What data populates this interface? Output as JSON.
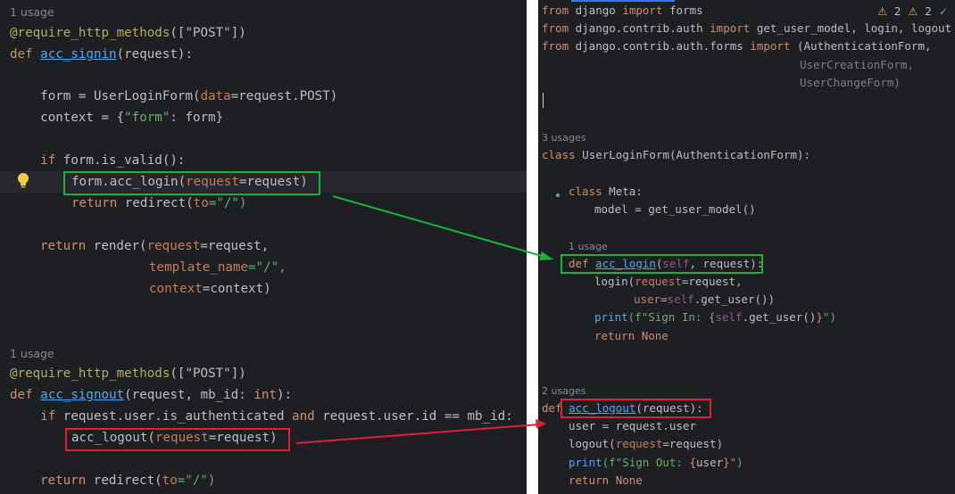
{
  "left": {
    "usage1": "1 usage",
    "deco1": "@require_http_methods",
    "deco1_arg": "([\"POST\"])",
    "def_kw": "def ",
    "signin_name": "acc_signin",
    "signin_sig": "(request):",
    "form_line": "    form = UserLoginForm(",
    "form_data_kw": "data",
    "form_data_val": "=request.POST)",
    "ctx_pre": "    context = {",
    "ctx_key": "\"form\"",
    "ctx_post": ": form}",
    "if_kw": "    if",
    "if_rest": " form.is_valid():",
    "login_call": "form.acc_login(",
    "login_param": "request",
    "login_val": "=request)",
    "return_kw": "return",
    "redirect_pre": " redirect(",
    "to_param": "to",
    "redirect_str": "=\"/\")",
    "render_pre": " render(",
    "req_param": "request",
    "req_val": "=request,",
    "tmpl_param": "template_name",
    "tmpl_val": "=\"/\",",
    "ctx_param": "context",
    "ctx_val": "=context)",
    "usage2": "1 usage",
    "deco2": "@require_http_methods",
    "deco2_arg": "([\"POST\"])",
    "signout_name": "acc_signout",
    "signout_sig": "(request, mb_id: ",
    "int_kw": "int",
    "signout_end": "):",
    "if2_mid": " request.user.is_authenticated ",
    "and_kw": "and",
    "if2_end": " request.user.id == mb_id:",
    "logout_call": "acc_logout(",
    "logout_param": "request",
    "logout_val": "=request)"
  },
  "right": {
    "warn1": "2",
    "warn2": "2",
    "from_kw": "from",
    "import_kw": "import",
    "imp1_mod": " django ",
    "imp1_names": " forms",
    "imp2_mod": " django.contrib.auth ",
    "imp2_names": " get_user_model, login, logout",
    "imp3_mod": " django.contrib.auth.forms ",
    "imp3_names": " (AuthenticationForm,",
    "imp3_cont1": "UserCreationForm,",
    "imp3_cont2": "UserChangeForm)",
    "usage3": "3 usages",
    "class_kw": "class",
    "class_rest": " UserLoginForm(AuthenticationForm):",
    "meta_rest": " Meta:",
    "model_line": "model = get_user_model()",
    "usage1": "1 usage",
    "def_kw": "def",
    "login_name": "acc_login",
    "self_kw": "self",
    "login_sig_end": ", request):",
    "login_call": "login(",
    "request_param": "request",
    "request_val": "=request,",
    "user_param": "user",
    "user_eq": "=",
    "get_user": ".get_user())",
    "print_fn": "print",
    "fstr_in_pre": "(f\"Sign In: ",
    "fstr_in_lb": "{",
    "fstr_in_expr": ".get_user()",
    "fstr_in_rb": "}",
    "fstr_in_end": "\")",
    "return_kw": "return",
    "none_kw": "None",
    "usage2": "2 usages",
    "logout_name": "acc_logout",
    "logout_sig": "(request):",
    "user_line": "user = request.user",
    "logout_call": "logout(",
    "logout_val": "=request)",
    "fstr_out_pre": "(f\"Sign Out: ",
    "fstr_out_expr": "user",
    "fstr_out_end": "\")"
  },
  "colors": {
    "editor_bg": "#1e1f22",
    "green_box": "#17b33b",
    "red_box": "#e0203a",
    "keyword": "#cf8e6d",
    "function": "#56a8f5",
    "string": "#6aab73"
  }
}
